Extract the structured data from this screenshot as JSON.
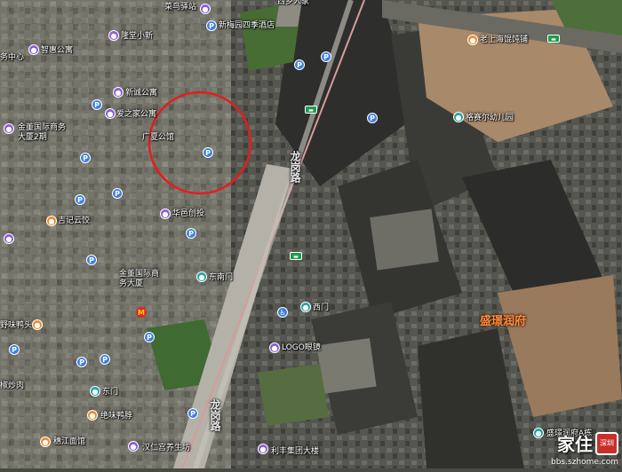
{
  "map": {
    "roads": {
      "road_upper": "龙岗路",
      "road_lower": "龙岗路"
    },
    "labels": {
      "caiwu_station": "菜鸟驿站",
      "xinmeiyuan_hotel": "新梅园四季酒店",
      "longtang_xiaoxin": "隆堂小新",
      "zhihui_apartment": "智惠公寓",
      "wu_center": "务中心",
      "xinshi_apartment": "新诚公寓",
      "aizhijia_apartment": "爱之家公寓",
      "guangxia_apartment": "广夏公馆",
      "jinzhong_intl_2": "金董国际商务大厦2期",
      "huayi_chuangtou": "华邑创投",
      "jinzhong_intl_building": "金董国际商务大厦",
      "jiji_yunjiao": "吉记云饺",
      "dongnanmen": "东南门",
      "ximen": "西门",
      "logo_optics": "LOGO眼镜",
      "yewei_yatou": "野味鸭头",
      "chaorou": "椒炒肉",
      "dongmen": "东门",
      "juewei_yabo": "绝味鸭脖",
      "suijiang_restaurant": "穗江面馆",
      "hanren_shengwu": "汉仁宫养生坊",
      "lifeng_group": "利丰集团大楼",
      "laoshanghai": "老上海馄饨铺",
      "gesai_kindergarten": "格赛尔幼儿园",
      "shenghui_runfu": "盛璟润府",
      "shenghui_runfu_a": "盛璟润府A栋",
      "xisanren_home": "西乡人家"
    },
    "watermark": {
      "logo_text": "家住",
      "logo_badge": "深圳",
      "url": "bbs.szhome.com"
    },
    "colors": {
      "highlight_circle": "#e01f1f",
      "district_label": "#ff8a3d",
      "parking_pin": "#3d7fe0",
      "transit_pin": "#1e9d4b"
    },
    "icons": {
      "parking": "parking-pin-icon",
      "venue": "venue-pin-icon",
      "food": "food-pin-icon",
      "transit": "bus-stop-icon",
      "mcdonalds": "mcdonalds-icon",
      "school": "school-pin-icon"
    }
  }
}
